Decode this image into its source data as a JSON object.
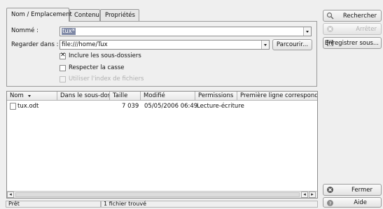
{
  "tabs": [
    {
      "label": "Nom / Emplacement",
      "active": true
    },
    {
      "label": "Contenu",
      "active": false
    },
    {
      "label": "Propriétés",
      "active": false
    }
  ],
  "search_form": {
    "named_label": "Nommé :",
    "named_value": "tux*",
    "look_in_label": "Regarder dans :",
    "look_in_value": "file:///home/Tux",
    "browse_label": "Parcourir...",
    "include_subfolders": {
      "label": "Inclure les sous-dossiers",
      "checked": true,
      "enabled": true
    },
    "case_sensitive": {
      "label": "Respecter la casse",
      "checked": false,
      "enabled": true
    },
    "use_index": {
      "label": "Utiliser l'index de fichiers",
      "checked": false,
      "enabled": false
    }
  },
  "results": {
    "columns": [
      "Nom",
      "Dans le sous-dossier",
      "Taille",
      "Modifié",
      "Permissions",
      "Première ligne correspondante"
    ],
    "sort_indicator": "chevron-down-icon",
    "rows": [
      {
        "name": "tux.odt",
        "subfolder": "",
        "size": "7 039",
        "modified": "05/05/2006 06:49",
        "permissions": "Lecture-écriture",
        "first_line": ""
      }
    ]
  },
  "actions": {
    "search": "Rechercher",
    "stop": "Arrêter",
    "save_as": "Enregistrer sous...",
    "close": "Fermer",
    "help": "Aide"
  },
  "status": {
    "state": "Prêt",
    "count": "1 fichier trouvé"
  },
  "colors": {
    "background": "#efefef",
    "selection": "#7f89a6",
    "border": "#9a9a9a"
  }
}
